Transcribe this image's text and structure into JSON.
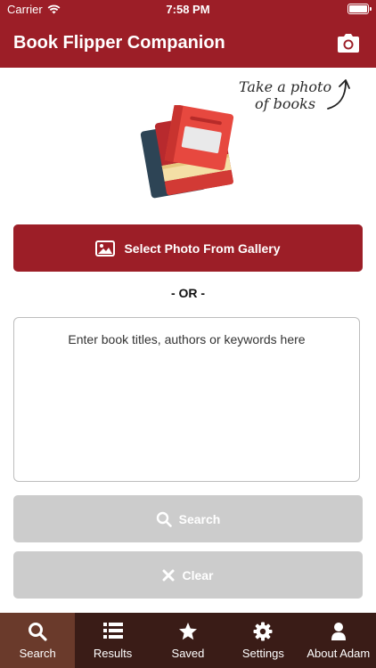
{
  "status_bar": {
    "carrier": "Carrier",
    "time": "7:58 PM"
  },
  "nav": {
    "title": "Book Flipper Companion"
  },
  "hero": {
    "hint_line1": "Take a photo",
    "hint_line2": "of books"
  },
  "actions": {
    "gallery_label": "Select Photo From Gallery",
    "or_label": "- OR -",
    "search_label": "Search",
    "clear_label": "Clear"
  },
  "query": {
    "value": "",
    "placeholder": "Enter book titles, authors or keywords here"
  },
  "tabs": [
    {
      "label": "Search",
      "icon": "search-icon"
    },
    {
      "label": "Results",
      "icon": "list-icon"
    },
    {
      "label": "Saved",
      "icon": "star-icon"
    },
    {
      "label": "Settings",
      "icon": "gear-icon"
    },
    {
      "label": "About Adam",
      "icon": "person-icon"
    }
  ],
  "colors": {
    "brand": "#9c1e27",
    "tab_bar": "#3a1c17",
    "tab_active": "#6a3a2b",
    "disabled": "#cccccc"
  }
}
